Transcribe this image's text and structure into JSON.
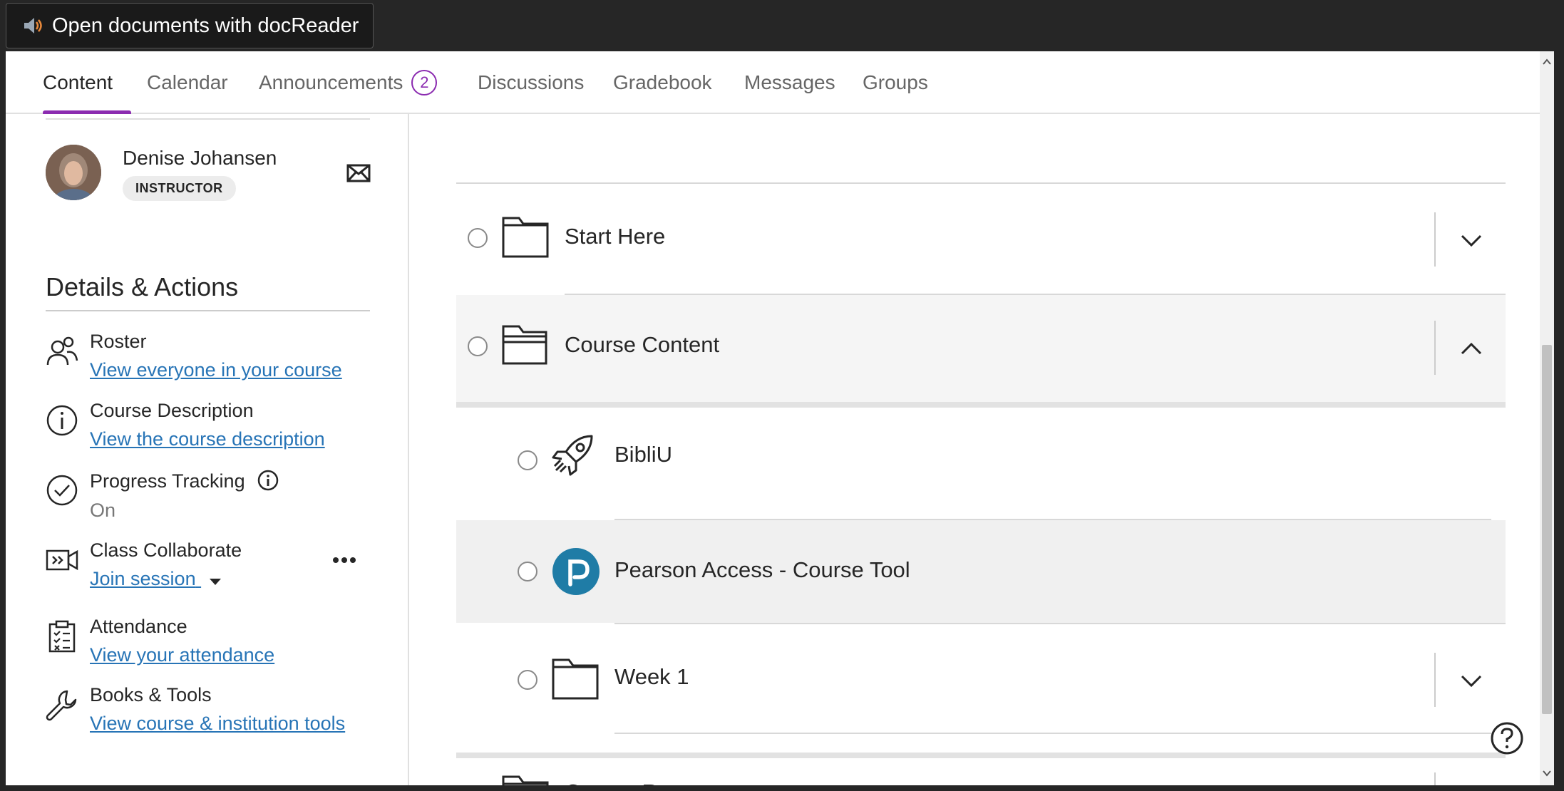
{
  "docreader": {
    "label": "Open documents with docReader",
    "icon": "speaker-icon"
  },
  "nav": {
    "tabs": [
      {
        "label": "Content",
        "active": true
      },
      {
        "label": "Calendar"
      },
      {
        "label": "Announcements",
        "badge": "2"
      },
      {
        "label": "Discussions"
      },
      {
        "label": "Gradebook"
      },
      {
        "label": "Messages"
      },
      {
        "label": "Groups"
      }
    ],
    "accent": "#8b2bb0"
  },
  "instructor": {
    "name": "Denise Johansen",
    "role": "INSTRUCTOR"
  },
  "details": {
    "title": "Details & Actions",
    "actions": [
      {
        "label": "Roster",
        "link": "View everyone in your course",
        "icon": "roster-icon"
      },
      {
        "label": "Course Description",
        "link": "View the course description",
        "icon": "info-icon"
      },
      {
        "label": "Progress Tracking",
        "status": "On",
        "icon": "check-circle-icon"
      },
      {
        "label": "Class Collaborate",
        "link": "Join session",
        "icon": "video-icon"
      },
      {
        "label": "Attendance",
        "link": "View your attendance",
        "icon": "clipboard-icon"
      },
      {
        "label": "Books & Tools",
        "link": "View course & institution tools",
        "icon": "wrench-icon"
      }
    ]
  },
  "content": {
    "items": [
      {
        "title": "Start Here",
        "icon": "folder-icon",
        "expanded": false
      },
      {
        "title": "Course Content",
        "icon": "folder-open-icon",
        "expanded": true
      },
      {
        "title": "BibliU",
        "icon": "rocket-icon"
      },
      {
        "title": "Pearson Access - Course Tool",
        "icon": "pearson-icon"
      },
      {
        "title": "Week 1",
        "icon": "folder-icon",
        "expanded": false
      },
      {
        "title": "Course Resources",
        "icon": "folder-icon",
        "expanded": false
      }
    ]
  },
  "colors": {
    "link": "#2774b6",
    "pearson": "#1f7ca6"
  }
}
